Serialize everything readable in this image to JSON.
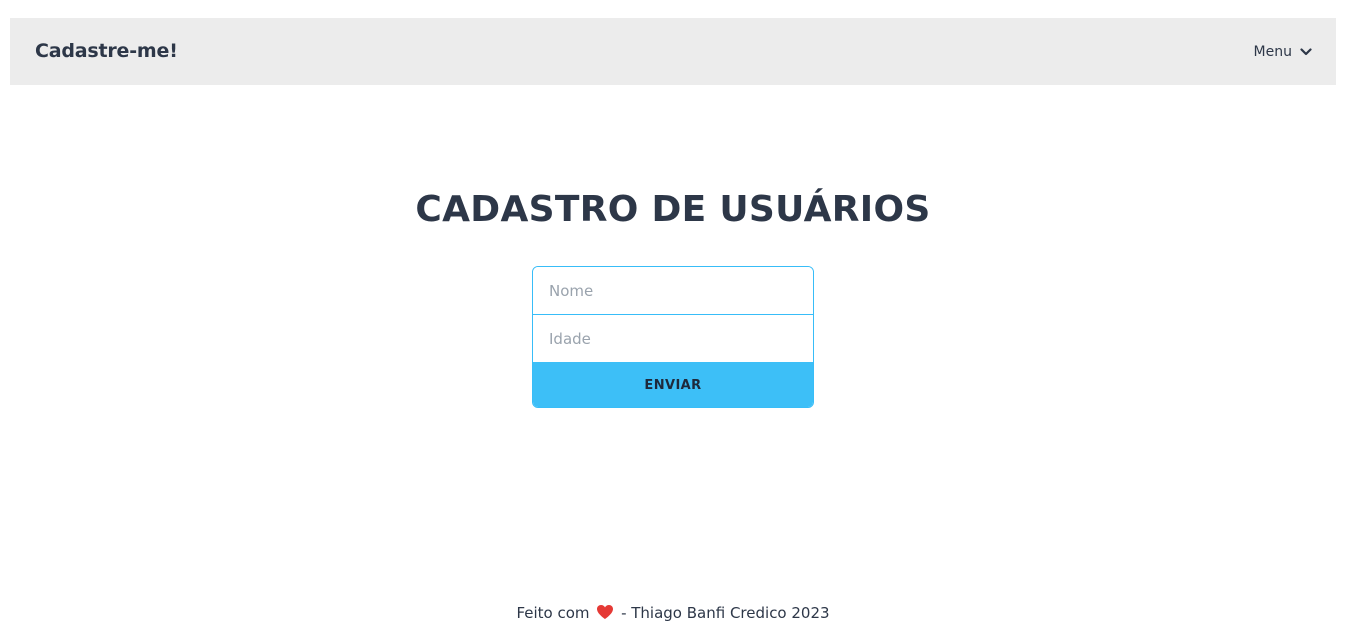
{
  "navbar": {
    "brand": "Cadastre-me!",
    "menu_label": "Menu",
    "menu_icon": "chevron-down-icon"
  },
  "main": {
    "title": "CADASTRO DE USUÁRIOS",
    "form": {
      "name_placeholder": "Nome",
      "name_value": "",
      "age_placeholder": "Idade",
      "age_value": "",
      "submit_label": "ENVIAR"
    }
  },
  "footer": {
    "prefix": "Feito com",
    "heart_icon": "heart-icon",
    "suffix": "- Thiago Banfi Credico 2023"
  },
  "colors": {
    "navbar_bg": "#ececec",
    "accent": "#3dbff7",
    "text": "#2d3748",
    "heart": "#e53935"
  }
}
